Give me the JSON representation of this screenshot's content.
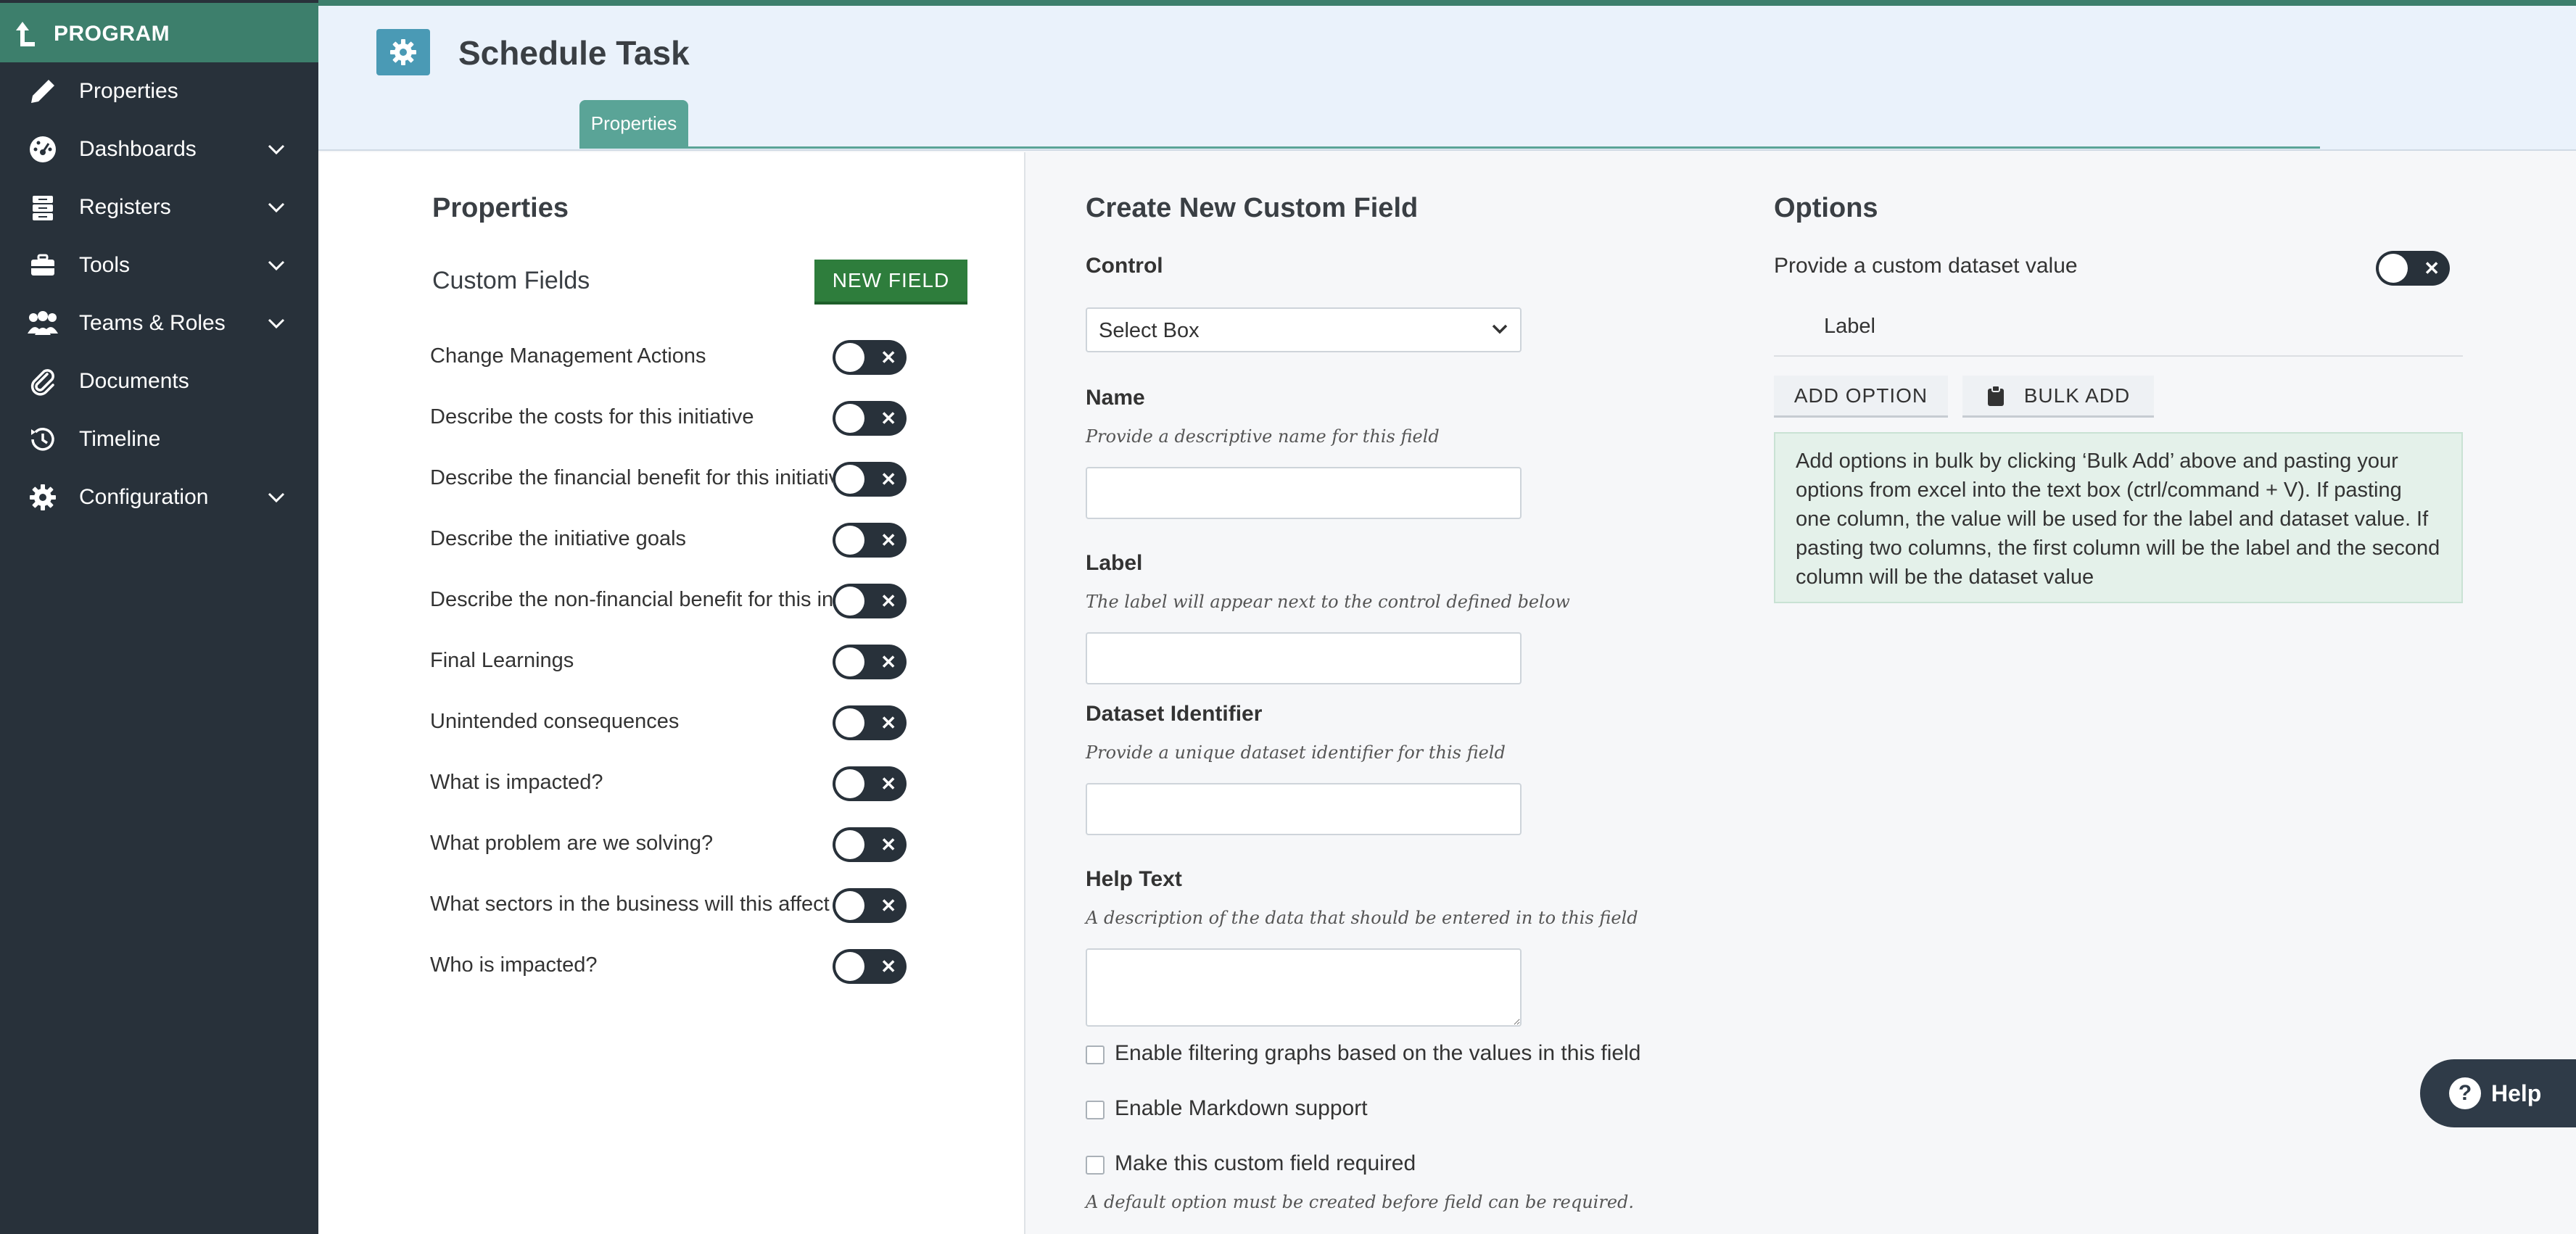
{
  "sidebar": {
    "program_label": "PROGRAM",
    "items": [
      {
        "label": "Properties",
        "icon": "pencil-icon",
        "has_chevron": false
      },
      {
        "label": "Dashboards",
        "icon": "dashboard-icon",
        "has_chevron": true
      },
      {
        "label": "Registers",
        "icon": "register-icon",
        "has_chevron": true
      },
      {
        "label": "Tools",
        "icon": "toolbox-icon",
        "has_chevron": true
      },
      {
        "label": "Teams & Roles",
        "icon": "users-icon",
        "has_chevron": true
      },
      {
        "label": "Documents",
        "icon": "paperclip-icon",
        "has_chevron": false
      },
      {
        "label": "Timeline",
        "icon": "history-icon",
        "has_chevron": false
      },
      {
        "label": "Configuration",
        "icon": "gear-icon",
        "has_chevron": true
      }
    ]
  },
  "header": {
    "title": "Schedule Task",
    "tabs": [
      {
        "label": "Properties",
        "active": true
      }
    ]
  },
  "properties": {
    "heading": "Properties",
    "custom_fields_label": "Custom Fields",
    "new_field_button": "NEW FIELD",
    "fields": [
      {
        "name": "Change Management Actions",
        "enabled": false
      },
      {
        "name": "Describe the costs for this initiative",
        "enabled": false
      },
      {
        "name": "Describe the financial benefit for this initiative",
        "enabled": false
      },
      {
        "name": "Describe the initiative goals",
        "enabled": false
      },
      {
        "name": "Describe the non-financial benefit for this initiative",
        "enabled": false
      },
      {
        "name": "Final Learnings",
        "enabled": false
      },
      {
        "name": "Unintended consequences",
        "enabled": false
      },
      {
        "name": "What is impacted?",
        "enabled": false
      },
      {
        "name": "What problem are we solving?",
        "enabled": false
      },
      {
        "name": "What sectors in the business will this affect",
        "enabled": false
      },
      {
        "name": "Who is impacted?",
        "enabled": false
      }
    ]
  },
  "create_field": {
    "heading": "Create New Custom Field",
    "control_label": "Control",
    "control_value": "Select Box",
    "name_label": "Name",
    "name_hint": "Provide a descriptive name for this field",
    "name_value": "",
    "label_label": "Label",
    "label_hint": "The label will appear next to the control defined below",
    "label_value": "",
    "dataset_label": "Dataset Identifier",
    "dataset_hint": "Provide a unique dataset identifier for this field",
    "dataset_value": "",
    "help_label": "Help Text",
    "help_hint": "A description of the data that should be entered in to this field",
    "help_value": "",
    "checkboxes": [
      {
        "label": "Enable filtering graphs based on the values in this field",
        "checked": false
      },
      {
        "label": "Enable Markdown support",
        "checked": false
      },
      {
        "label": "Make this custom field required",
        "checked": false
      }
    ],
    "required_note": "A default option must be created before field can be required."
  },
  "options": {
    "heading": "Options",
    "custom_dataset_label": "Provide a custom dataset value",
    "custom_dataset_enabled": false,
    "column_label": "Label",
    "add_option_button": "ADD OPTION",
    "bulk_add_button": "BULK ADD",
    "bulk_note": "Add options in bulk by clicking ‘Bulk Add’ above and pasting your options from excel into the text box (ctrl/command + V). If pasting one column, the value will be used for the label and dataset value. If pasting two columns, the first column will be the label and the second column will be the dataset value"
  },
  "help_button": "Help",
  "colors": {
    "sidebar_bg": "#28313a",
    "program_bg": "#3d7f6c",
    "tab_active": "#5aa497",
    "new_field_bg": "#2e7d3c",
    "header_icon_bg": "#4a9ab5",
    "note_bg": "#e4f1ea"
  }
}
